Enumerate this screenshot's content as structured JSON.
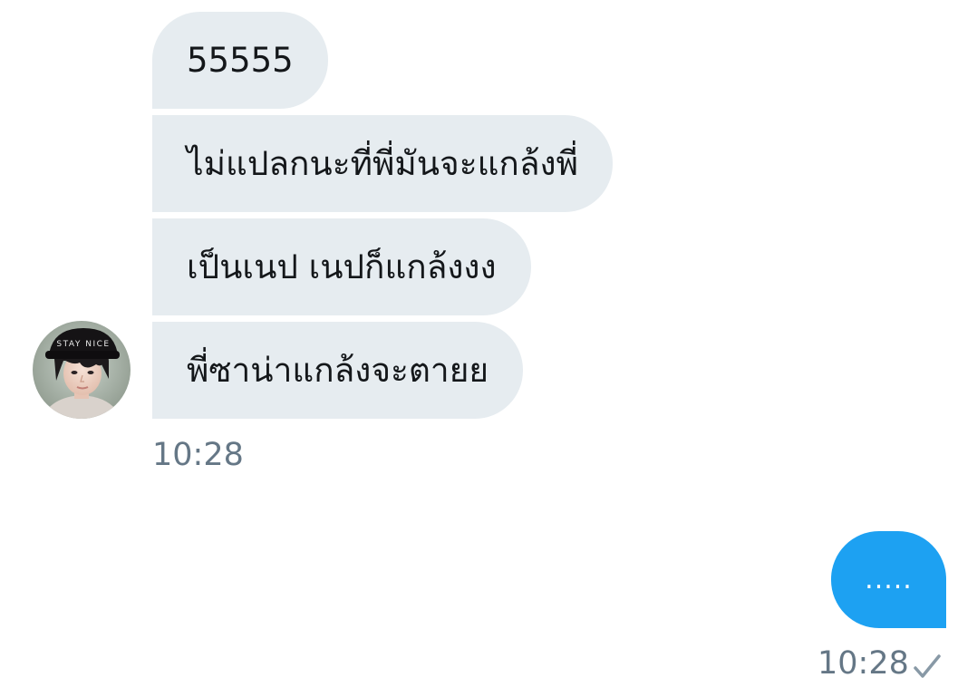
{
  "conversation": {
    "incoming": {
      "messages": [
        "55555",
        "ไม่แปลกนะที่พี่มันจะแกล้งพี่",
        "เป็นเนป เนปก็แกล้งงง",
        "พี่ซาน่าแกล้งจะตายย"
      ],
      "avatar_cap_text": "STAY NICE",
      "timestamp": "10:28"
    },
    "outgoing": {
      "message": ".....",
      "timestamp": "10:28",
      "status_icon": "checkmark-icon"
    }
  },
  "colors": {
    "incoming_bubble": "#e6ecf0",
    "outgoing_bubble": "#1da1f2",
    "timestamp": "#657786",
    "text": "#14171a"
  }
}
